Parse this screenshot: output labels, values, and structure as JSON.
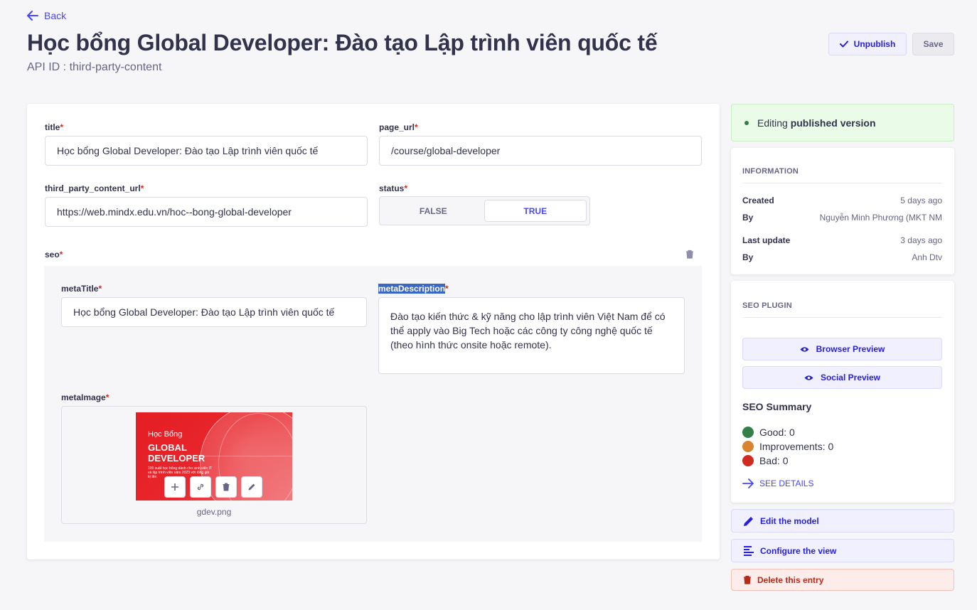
{
  "header": {
    "back_label": "Back",
    "title": "Học bổng Global Developer: Đào tạo Lập trình viên quốc tế",
    "api_id": "API ID : third-party-content",
    "unpublish_label": "Unpublish",
    "save_label": "Save"
  },
  "form": {
    "title": {
      "label": "title",
      "value": "Học bổng Global Developer: Đào tạo Lập trình viên quốc tế"
    },
    "page_url": {
      "label": "page_url",
      "value": "/course/global-developer"
    },
    "third_party_content_url": {
      "label": "third_party_content_url",
      "value": "https://web.mindx.edu.vn/hoc--bong-global-developer"
    },
    "status": {
      "label": "status",
      "false_label": "FALSE",
      "true_label": "TRUE",
      "selected": "TRUE"
    },
    "seo": {
      "label": "seo",
      "metaTitle": {
        "label": "metaTitle",
        "value": "Học bổng Global Developer: Đào tạo Lập trình viên quốc tế"
      },
      "metaDescription": {
        "label": "metaDescription",
        "value": "Đào tạo kiến thức & kỹ năng cho lập trình viên Việt Nam để có thể apply vào Big Tech hoặc các công ty công nghệ quốc tế (theo hình thức onsite hoặc remote)."
      },
      "metaImage": {
        "label": "metaImage",
        "file_name": "gdev.png",
        "thumb_small": "Học Bổng",
        "thumb_big_1": "GLOBAL",
        "thumb_big_2": "DEVELOPER",
        "thumb_sub": "100 suất học bổng dành cho sinh viên IT và lập trình viên năm 2023 với tổng giá trị lên"
      }
    }
  },
  "sidebar": {
    "editing_prefix": "Editing ",
    "editing_strong": "published version",
    "information": {
      "title": "INFORMATION",
      "created_label": "Created",
      "created_value": "5 days ago",
      "by_label": "By",
      "created_by": "Nguyễn Minh Phương (MKT NM",
      "last_update_label": "Last update",
      "last_update_value": "3 days ago",
      "updated_by": "Anh Dtv"
    },
    "seo_plugin": {
      "title": "SEO PLUGIN",
      "browser_preview": "Browser Preview",
      "social_preview": "Social Preview",
      "summary_title": "SEO Summary",
      "good": "Good: 0",
      "improvements": "Improvements: 0",
      "bad": "Bad: 0",
      "see_details": "SEE DETAILS",
      "colors": {
        "good": "#328048",
        "improvements": "#d9822f",
        "bad": "#d02b20"
      }
    },
    "actions": {
      "edit_model": "Edit the model",
      "configure_view": "Configure the view",
      "delete_entry": "Delete this entry"
    }
  }
}
